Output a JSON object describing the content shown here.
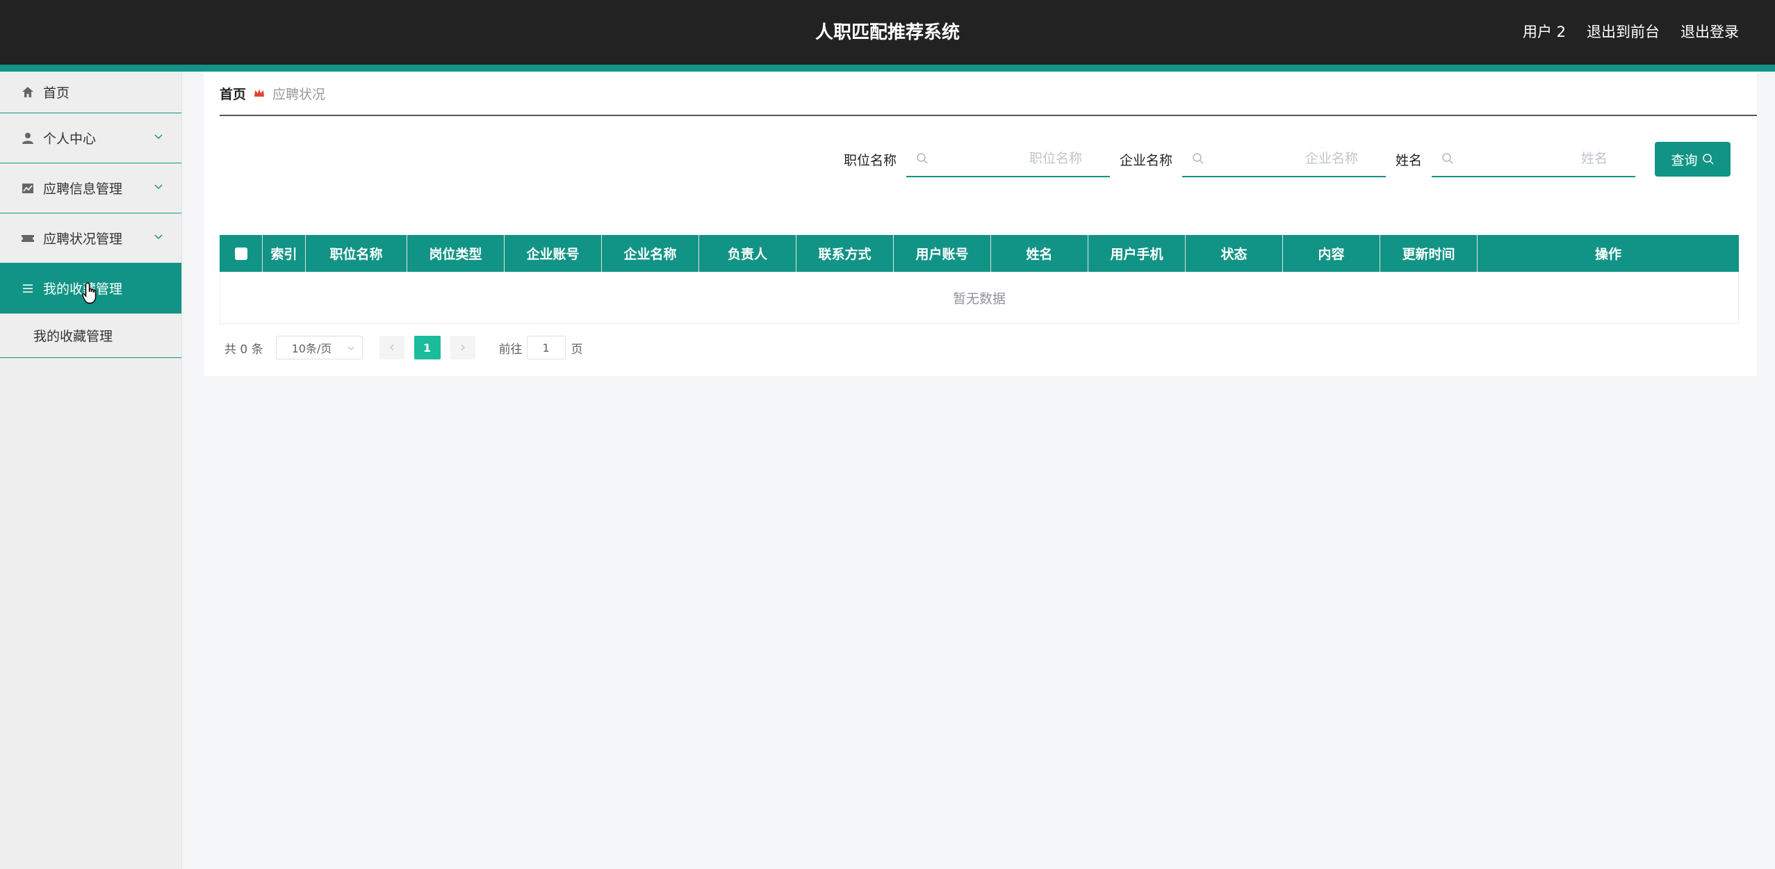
{
  "app": {
    "title": "人职匹配推荐系统"
  },
  "top_nav": {
    "user": "用户 2",
    "front": "退出到前台",
    "logout": "退出登录"
  },
  "sidebar": {
    "items": [
      {
        "label": "首页",
        "icon": "home-icon"
      },
      {
        "label": "个人中心",
        "icon": "user-icon"
      },
      {
        "label": "应聘信息管理",
        "icon": "chart-icon"
      },
      {
        "label": "应聘状况管理",
        "icon": "ticket-icon"
      },
      {
        "label": "我的收藏管理",
        "icon": "list-icon"
      }
    ],
    "submenu": {
      "label": "我的收藏管理"
    }
  },
  "breadcrumb": {
    "home": "首页",
    "current": "应聘状况"
  },
  "search": {
    "fields": [
      {
        "label": "职位名称",
        "placeholder": "职位名称"
      },
      {
        "label": "企业名称",
        "placeholder": "企业名称"
      },
      {
        "label": "姓名",
        "placeholder": "姓名"
      }
    ],
    "button": "查询"
  },
  "table": {
    "columns": [
      "索引",
      "职位名称",
      "岗位类型",
      "企业账号",
      "企业名称",
      "负责人",
      "联系方式",
      "用户账号",
      "姓名",
      "用户手机",
      "状态",
      "内容",
      "更新时间",
      "操作"
    ],
    "empty_text": "暂无数据"
  },
  "pagination": {
    "total": "共 0 条",
    "page_size": "10条/页",
    "current_page": "1",
    "goto_label": "前往",
    "goto_value": "1",
    "page_label": "页"
  },
  "colors": {
    "accent": "#119485",
    "topbar": "#222222",
    "page_active": "#1abc9c"
  }
}
